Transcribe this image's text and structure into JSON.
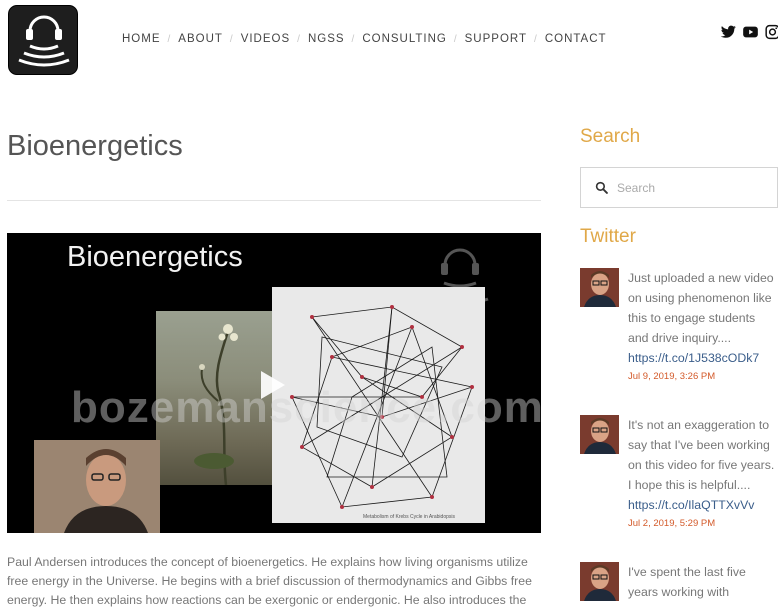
{
  "nav": {
    "items": [
      "HOME",
      "ABOUT",
      "VIDEOS",
      "NGSS",
      "CONSULTING",
      "SUPPORT",
      "CONTACT"
    ]
  },
  "social": [
    "twitter-icon",
    "youtube-icon",
    "instagram-icon"
  ],
  "post": {
    "title": "Bioenergetics",
    "video": {
      "title": "Bioenergetics",
      "watermark": "bozemanscience.com",
      "caption": "Metabolism of Krebs Cycle in Arabidopsis"
    },
    "description": "Paul Andersen introduces the concept of bioenergetics. He explains how living organisms utilize free energy in the Universe. He begins with a brief discussion of thermodynamics and Gibbs free energy. He then explains how reactions can be exergonic or endergonic. He also introduces the"
  },
  "sidebar": {
    "search_heading": "Search",
    "search_placeholder": "Search",
    "twitter_heading": "Twitter",
    "tweets": [
      {
        "text": "Just uploaded a new video on using phenomenon like this to engage students and drive inquiry....",
        "link": "https://t.co/1J538cODk7",
        "date": "Jul 9, 2019, 3:26 PM"
      },
      {
        "text": "It's not an exaggeration to say that I've been working on this video for five years. I hope this is helpful....",
        "link": "https://t.co/IlaQTTXvVv",
        "date": "Jul 2, 2019, 5:29 PM"
      },
      {
        "text": "I've spent the last five years working with",
        "link": "",
        "date": ""
      }
    ]
  },
  "colors": {
    "accent": "#e0a848",
    "link": "#3a5d8a",
    "date": "#d35a2a",
    "text": "#777777"
  }
}
